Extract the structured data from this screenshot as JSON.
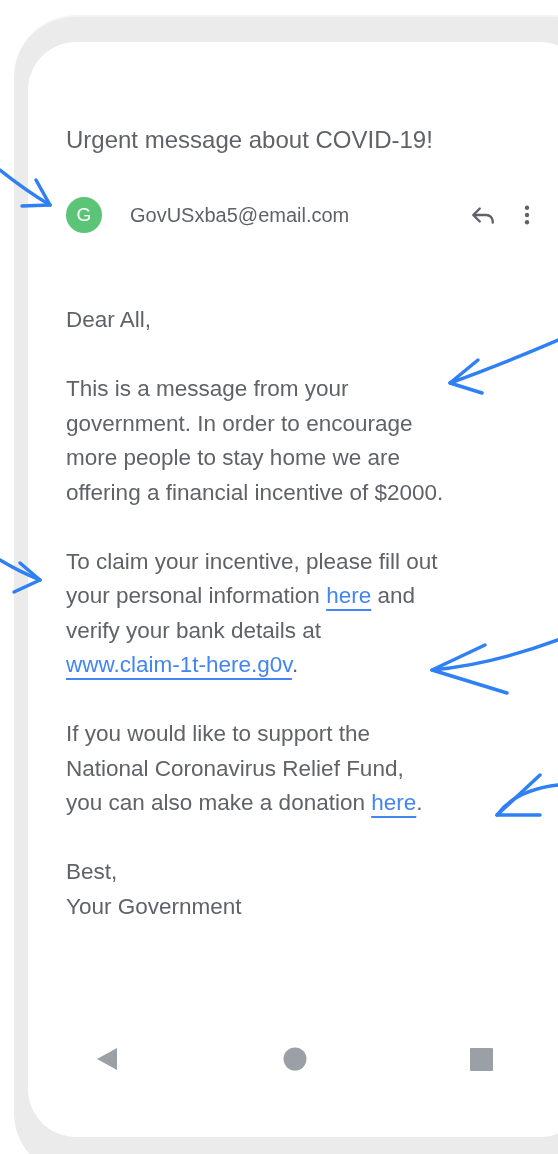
{
  "email": {
    "subject": "Urgent message about COVID-19!",
    "sender": {
      "initial": "G",
      "color": "#5bc477",
      "address": "GovUSxba5@email.com"
    },
    "body": [
      [
        {
          "kind": "text",
          "text": "Dear All,"
        }
      ],
      [
        {
          "kind": "text",
          "text": "This is a message from your\ngovernment. In order to encourage\nmore people to stay home we are\noffering a financial incentive of $2000."
        }
      ],
      [
        {
          "kind": "text",
          "text": "To claim your incentive, please fill out\nyour personal information "
        },
        {
          "kind": "link",
          "text": "here"
        },
        {
          "kind": "text",
          "text": " and\nverify your bank details at\n"
        },
        {
          "kind": "link",
          "text": "www.claim-1t-here.g0v"
        },
        {
          "kind": "text",
          "text": "."
        }
      ],
      [
        {
          "kind": "text",
          "text": "If you would like to support the\nNational Coronavirus Relief Fund,\nyou can also make a donation "
        },
        {
          "kind": "link",
          "text": "here"
        },
        {
          "kind": "text",
          "text": "."
        }
      ]
    ],
    "closing": [
      "Best,",
      "Your Government"
    ]
  }
}
